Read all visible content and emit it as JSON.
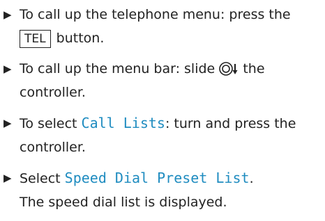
{
  "steps": [
    {
      "before": "To call up the telephone menu: press the",
      "key": "TEL",
      "after": " button."
    },
    {
      "before": "To call up the menu bar: slide",
      "after": " the controller."
    },
    {
      "before": "To select ",
      "highlight": "Call Lists",
      "after": ": turn and press the controller."
    },
    {
      "before": "Select ",
      "highlight": "Speed Dial Preset List",
      "after": ".",
      "result": "The speed dial list is displayed."
    }
  ],
  "colors": {
    "text": "#222222",
    "highlight": "#1f8cc0"
  },
  "icons": {
    "bullet": "triangle-bullet-icon",
    "controller": "controller-slide-down-icon"
  }
}
